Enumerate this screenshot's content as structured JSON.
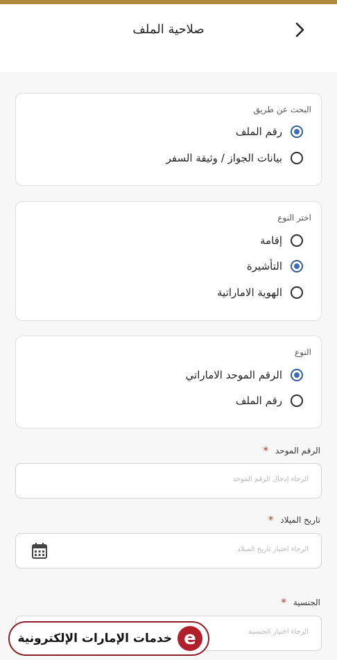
{
  "header": {
    "title": "صلاحية الملف",
    "back_icon": "chevron-right-icon"
  },
  "search_by": {
    "label": "البحث عن طريق",
    "options": [
      {
        "label": "رقم الملف",
        "checked": true
      },
      {
        "label": "بيانات الجواز / وثيقة السفر",
        "checked": false
      }
    ]
  },
  "choose_type": {
    "label": "اختر النوع",
    "options": [
      {
        "label": "إقامة",
        "checked": false
      },
      {
        "label": "التأشيرة",
        "checked": true
      },
      {
        "label": "الهوية الاماراتية",
        "checked": false
      }
    ]
  },
  "type": {
    "label": "النوع",
    "options": [
      {
        "label": "الرقم الموحد الاماراتي",
        "checked": true
      },
      {
        "label": "رقم الملف",
        "checked": false
      }
    ]
  },
  "fields": {
    "unified_number": {
      "label": "الرقم الموحد",
      "required": "*",
      "placeholder": "الرجاء إدخال الرقم الموحد"
    },
    "birth_date": {
      "label": "تاريخ الميلاد",
      "required": "*",
      "placeholder": "الرجاء اختيار تاريخ الميلاد",
      "icon": "calendar-icon"
    },
    "nationality": {
      "label": "الجنسية",
      "required": "*",
      "placeholder": "الرجاء اختيار الجنسية"
    }
  },
  "brand": {
    "text": "خدمات الإمارات الإلكترونية",
    "logo_letter": "e"
  },
  "colors": {
    "accent": "#b08a3e",
    "radio_checked": "#3f6db5",
    "required": "#c0392b",
    "brand": "#b0202b"
  }
}
